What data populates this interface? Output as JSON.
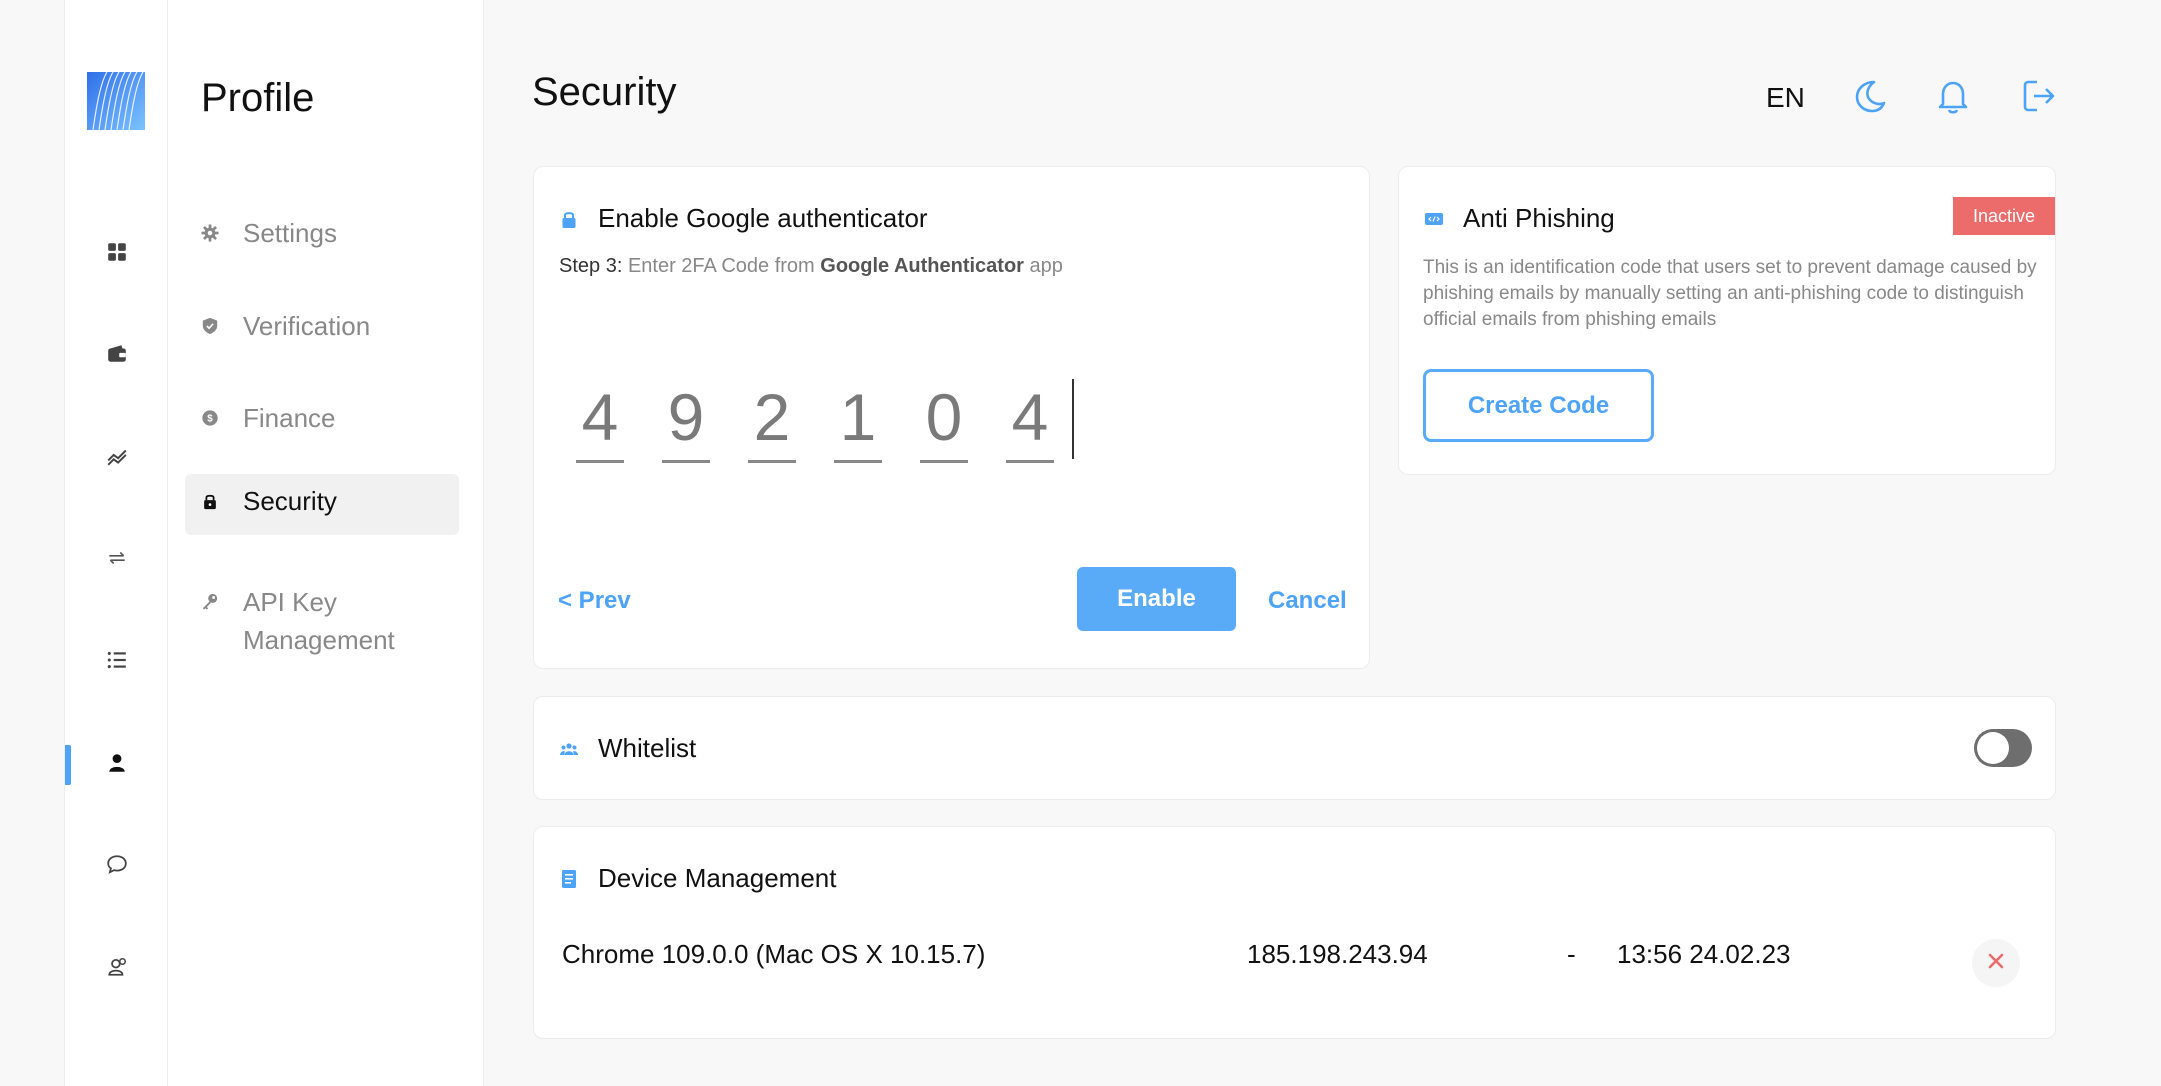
{
  "nav_rail": {
    "items": [
      {
        "name": "dashboard-icon"
      },
      {
        "name": "wallet-icon"
      },
      {
        "name": "chart-icon"
      },
      {
        "name": "transfer-icon"
      },
      {
        "name": "list-icon"
      },
      {
        "name": "user-icon",
        "active": true
      },
      {
        "name": "chat-icon"
      },
      {
        "name": "support-icon"
      }
    ]
  },
  "sidebar": {
    "title": "Profile",
    "items": [
      {
        "label": "Settings",
        "icon": "gear-icon"
      },
      {
        "label": "Verification",
        "icon": "shield-icon"
      },
      {
        "label": "Finance",
        "icon": "coin-icon"
      },
      {
        "label": "Security",
        "icon": "lock-icon",
        "active": true
      },
      {
        "label": "API Key Management",
        "icon": "key-icon"
      }
    ]
  },
  "header": {
    "title": "Security",
    "language": "EN",
    "icons": [
      "moon-icon",
      "bell-icon",
      "logout-icon"
    ]
  },
  "google_auth": {
    "title": "Enable Google authenticator",
    "step_label": "Step 3:",
    "step_text_1": " Enter 2FA Code from ",
    "step_app": "Google Authenticator",
    "step_text_2": " app",
    "code_digits": [
      "4",
      "9",
      "2",
      "1",
      "0",
      "4"
    ],
    "prev_label": "< Prev",
    "enable_label": "Enable",
    "cancel_label": "Cancel"
  },
  "anti_phishing": {
    "title": "Anti Phishing",
    "status": "Inactive",
    "description": "This is an identification code that users set to prevent damage caused by phishing emails by manually setting an anti-phishing code to distinguish official emails from phishing emails",
    "button_label": "Create Code"
  },
  "whitelist": {
    "title": "Whitelist",
    "enabled": false
  },
  "device_management": {
    "title": "Device Management",
    "devices": [
      {
        "browser": "Chrome 109.0.0 (Mac OS X 10.15.7)",
        "ip": "185.198.243.94",
        "location": "-",
        "time": "13:56 24.02.23"
      }
    ]
  },
  "colors": {
    "accent": "#4da3f7",
    "danger": "#ec6b6b",
    "toggle_off": "#6e6e6e"
  }
}
